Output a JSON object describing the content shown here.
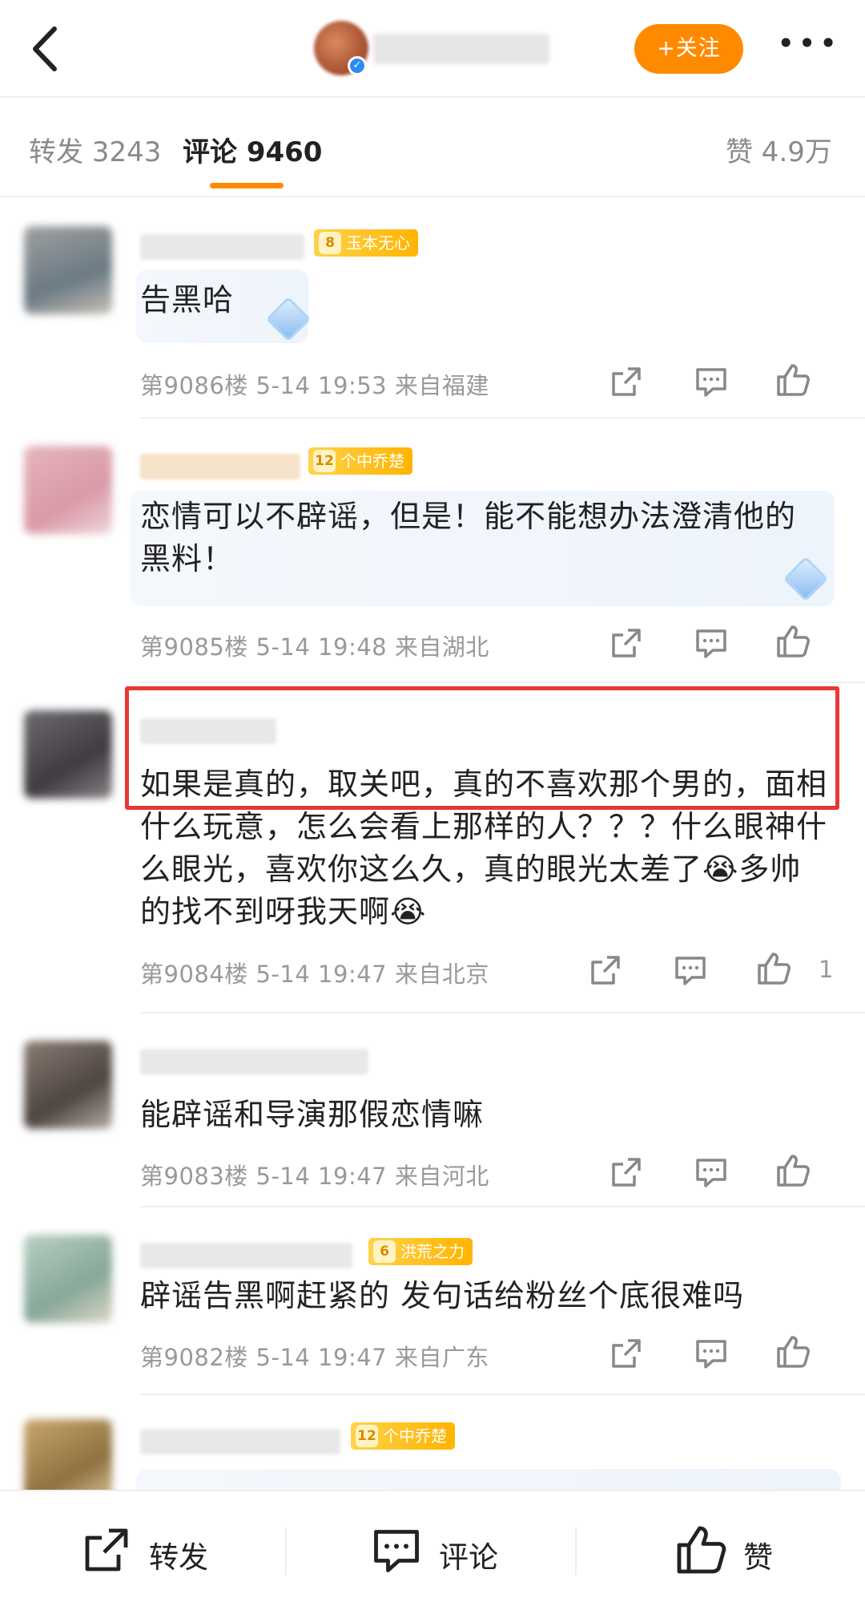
{
  "header": {
    "follow_label": "+关注",
    "more_label": "•••"
  },
  "tabs": [
    {
      "label": "转发 3243"
    },
    {
      "label": "评论 9460"
    },
    {
      "label": "赞 4.9万"
    }
  ],
  "comments": [
    {
      "badge": {
        "level": "8",
        "title": "玉本无心"
      },
      "text": "告黑哈",
      "meta": "第9086楼 5-14 19:53 来自福建",
      "likes": ""
    },
    {
      "badge": {
        "level": "12",
        "title": "个中乔楚"
      },
      "text": "恋情可以不辟谣，但是！能不能想办法澄清他的黑料！",
      "meta": "第9085楼 5-14 19:48 来自湖北",
      "likes": ""
    },
    {
      "badge": null,
      "text": "如果是真的，取关吧，真的不喜欢那个男的，面相什么玩意，怎么会看上那样的人？？？什么眼神什么眼光，喜欢你这么久，真的眼光太差了😭多帅的找不到呀我天啊😭",
      "meta": "第9084楼 5-14 19:47 来自北京",
      "likes": "1"
    },
    {
      "badge": null,
      "text": "能辟谣和导演那假恋情嘛",
      "meta": "第9083楼 5-14 19:47 来自河北",
      "likes": ""
    },
    {
      "badge": {
        "level": "6",
        "title": "洪荒之力"
      },
      "text": "辟谣告黑啊赶紧的 发句话给粉丝个底很难吗",
      "meta": "第9082楼 5-14 19:47 来自广东",
      "likes": ""
    },
    {
      "badge": {
        "level": "12",
        "title": "个中乔楚"
      },
      "text": "",
      "meta": "",
      "likes": ""
    }
  ],
  "bottom_bar": {
    "repost_label": "转发",
    "comment_label": "评论",
    "like_label": "赞"
  },
  "colors": {
    "accent": "#ff8a00",
    "highlight_border": "#e53935",
    "meta_gray": "#999999"
  },
  "icons": [
    "back-arrow-icon",
    "verified-icon",
    "more-icon",
    "share-icon",
    "comment-icon",
    "thumbs-up-icon",
    "gem-icon"
  ]
}
